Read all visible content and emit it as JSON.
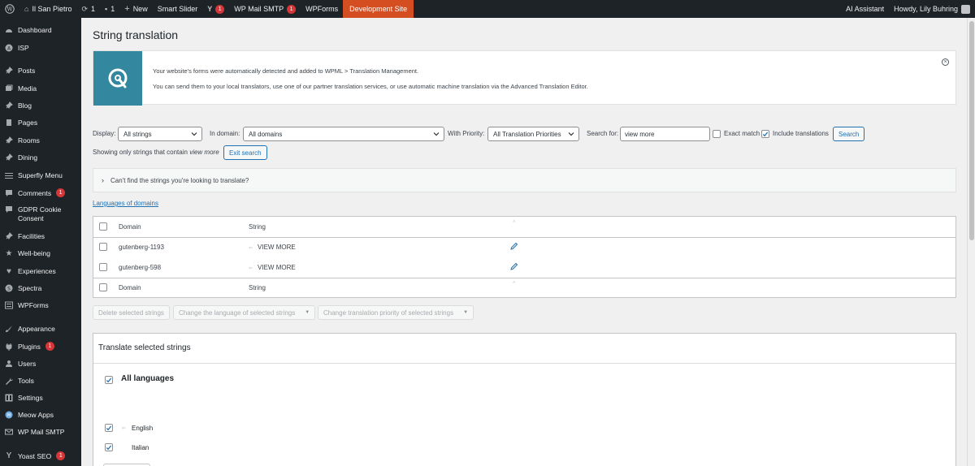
{
  "adminbar": {
    "site_name": "Il San Pietro",
    "updates_count": "1",
    "comments_count": "1",
    "new_label": "New",
    "smart_slider": "Smart Slider",
    "yoast_count": "1",
    "wp_mail_smtp": "WP Mail SMTP",
    "wp_mail_count": "1",
    "wpforms": "WPForms",
    "dev_site": "Development Site",
    "ai_assistant": "AI Assistant",
    "howdy": "Howdy, Lily Buhring",
    "colors": {
      "bar": "#1d2327",
      "dev_site": "#d54e21",
      "badge": "#d63638"
    }
  },
  "sidebar": {
    "items": [
      {
        "label": "Dashboard",
        "icon": "dashboard-icon"
      },
      {
        "label": "ISP",
        "icon": "isp-icon"
      },
      {
        "label": "Posts",
        "icon": "pin-icon"
      },
      {
        "label": "Media",
        "icon": "media-icon"
      },
      {
        "label": "Blog",
        "icon": "pin-icon"
      },
      {
        "label": "Pages",
        "icon": "pages-icon"
      },
      {
        "label": "Rooms",
        "icon": "pin-icon"
      },
      {
        "label": "Dining",
        "icon": "pin-icon"
      },
      {
        "label": "Superfly Menu",
        "icon": "menu-lines-icon"
      },
      {
        "label": "Comments",
        "icon": "comment-icon",
        "badge": "1"
      },
      {
        "label": "GDPR Cookie",
        "label2": "Consent",
        "icon": "cookie-icon"
      },
      {
        "label": "Facilities",
        "icon": "pin-icon"
      },
      {
        "label": "Well-being",
        "icon": "star-icon"
      },
      {
        "label": "Experiences",
        "icon": "heart-icon"
      },
      {
        "label": "Spectra",
        "icon": "spectra-icon"
      },
      {
        "label": "WPForms",
        "icon": "wpforms-icon"
      },
      {
        "label": "Appearance",
        "icon": "brush-icon"
      },
      {
        "label": "Plugins",
        "icon": "plug-icon",
        "badge": "1"
      },
      {
        "label": "Users",
        "icon": "users-icon"
      },
      {
        "label": "Tools",
        "icon": "wrench-icon"
      },
      {
        "label": "Settings",
        "icon": "settings-icon"
      },
      {
        "label": "Meow Apps",
        "icon": "meow-icon"
      },
      {
        "label": "WP Mail SMTP",
        "icon": "mail-icon"
      },
      {
        "label": "Yoast SEO",
        "icon": "yoast-icon",
        "badge": "1"
      }
    ]
  },
  "page": {
    "title": "String translation"
  },
  "notice": {
    "line1": "Your website's forms were automatically detected and added to WPML > Translation Management.",
    "line2": "You can send them to your local translators, use one of our partner translation services, or use automatic machine translation via the Advanced Translation Editor."
  },
  "filters": {
    "display_label": "Display:",
    "display_value": "All strings",
    "domain_label": "In domain:",
    "domain_value": "All domains",
    "priority_label": "With Priority:",
    "priority_value": "All Translation Priorities",
    "search_label": "Search for:",
    "search_value": "view more",
    "exact_match": "Exact match",
    "include_translations": "Include translations",
    "search_button": "Search",
    "showing_prefix": "Showing only strings that contain",
    "showing_term": "view more",
    "exit_search": "Exit search"
  },
  "collapse": {
    "text": "Can't find the strings you're looking to translate?"
  },
  "languages_link": "Languages of domains",
  "table": {
    "col_domain": "Domain",
    "col_string": "String",
    "rows": [
      {
        "domain": "gutenberg-1193",
        "string": "VIEW MORE"
      },
      {
        "domain": "gutenberg-598",
        "string": "VIEW MORE"
      }
    ]
  },
  "bulk": {
    "delete": "Delete selected strings",
    "change_language": "Change the language of selected strings",
    "change_priority": "Change translation priority of selected strings"
  },
  "translate_panel": {
    "title": "Translate selected strings",
    "all_languages": "All languages",
    "languages": [
      "English",
      "Italian"
    ]
  }
}
